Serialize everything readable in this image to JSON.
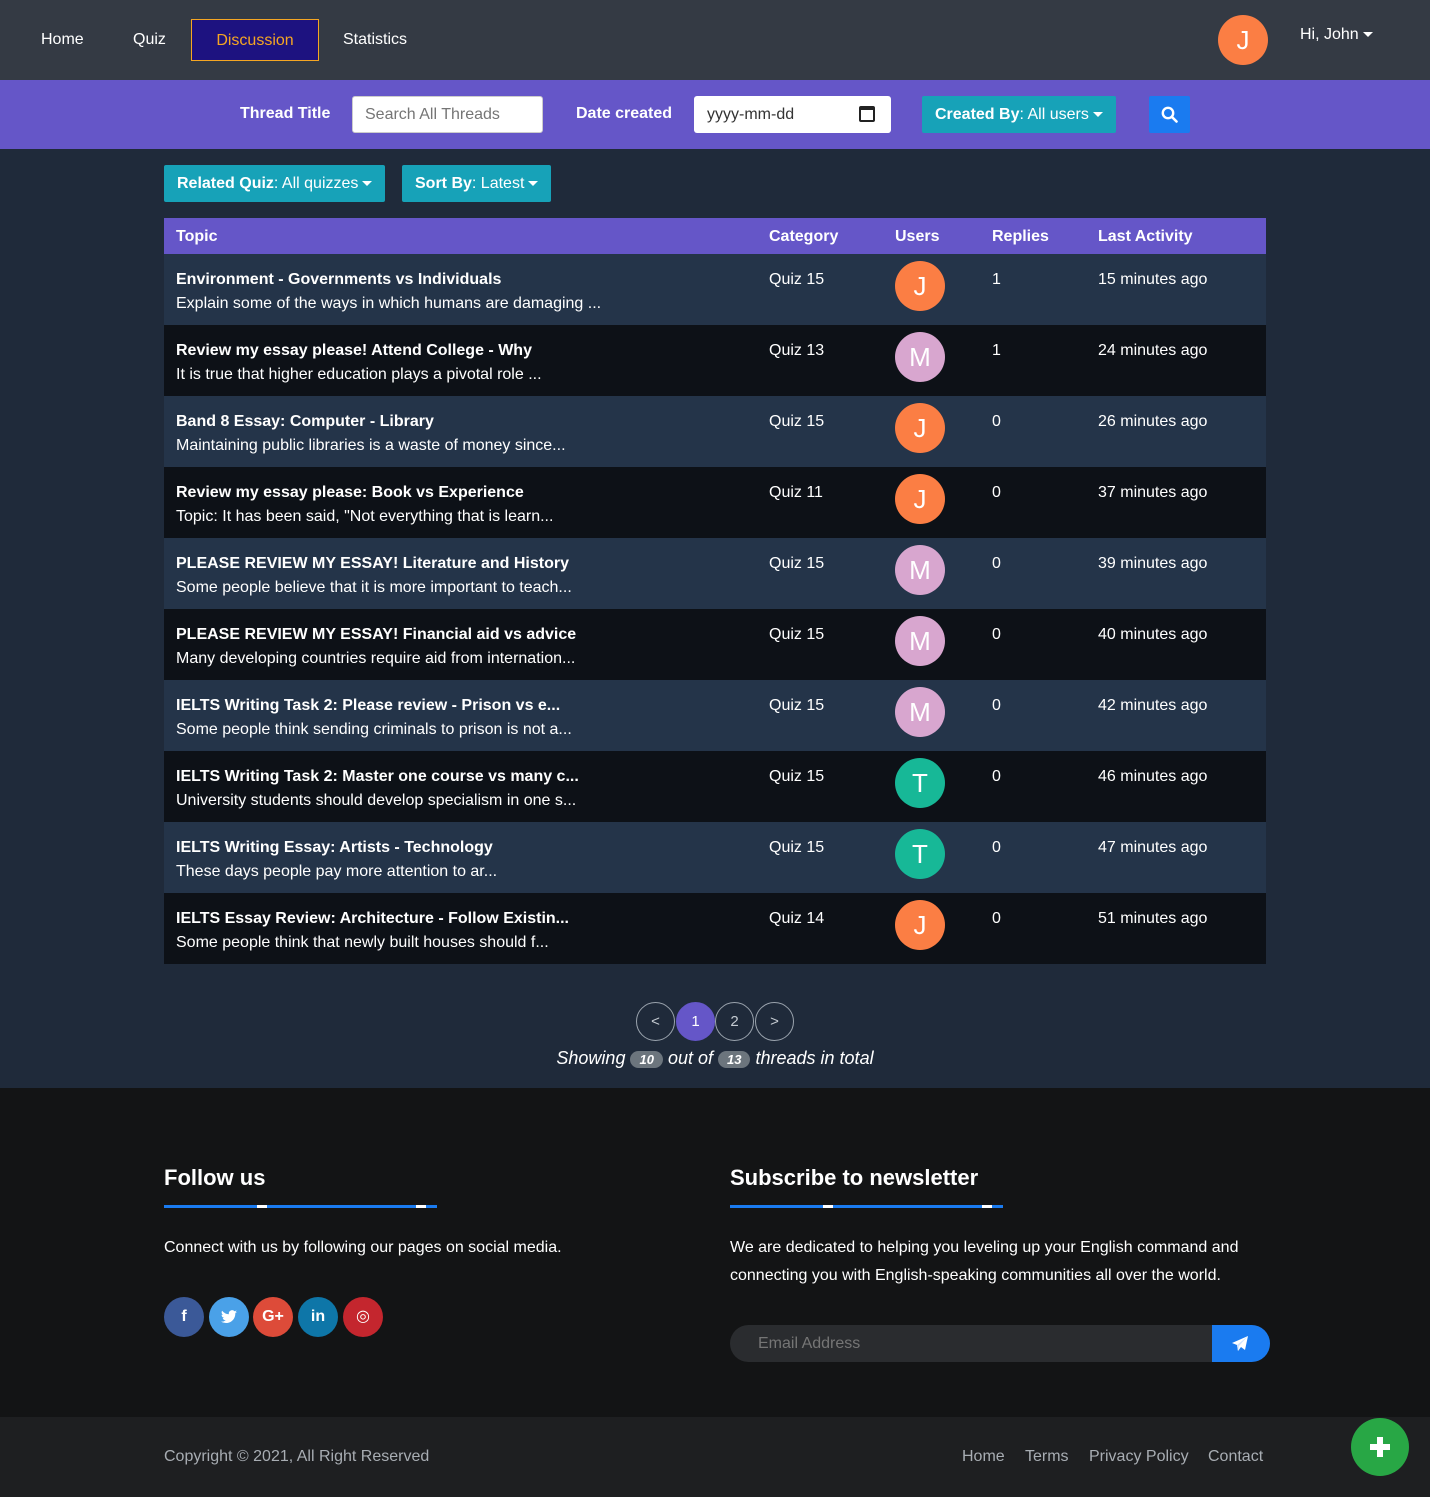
{
  "nav": {
    "items": [
      {
        "label": "Home"
      },
      {
        "label": "Quiz"
      },
      {
        "label": "Discussion"
      },
      {
        "label": "Statistics"
      }
    ],
    "avatar_letter": "J",
    "greeting": "Hi, John"
  },
  "filters": {
    "thread_title_label": "Thread Title",
    "search_placeholder": "Search All Threads",
    "date_label": "Date created",
    "date_placeholder": "yyyy-mm-dd",
    "created_by_key": "Created By",
    "created_by_value": ": All users",
    "related_quiz_key": "Related Quiz",
    "related_quiz_value": ": All quizzes",
    "sort_by_key": "Sort By",
    "sort_by_value": ": Latest"
  },
  "table": {
    "headers": {
      "topic": "Topic",
      "category": "Category",
      "users": "Users",
      "replies": "Replies",
      "last_activity": "Last Activity"
    },
    "rows": [
      {
        "title": "Environment - Governments vs Individuals",
        "excerpt": "Explain some of the ways in which humans are damaging ...",
        "category": "Quiz 15",
        "user": "J",
        "user_color": "#fb7e44",
        "replies": "1",
        "last": "15 minutes ago"
      },
      {
        "title": "Review my essay please! Attend College - Why",
        "excerpt": "It is true that higher education plays a pivotal role ...",
        "category": "Quiz 13",
        "user": "M",
        "user_color": "#d8a6cf",
        "replies": "1",
        "last": "24 minutes ago"
      },
      {
        "title": "Band 8 Essay: Computer - Library",
        "excerpt": "Maintaining public libraries is a waste of money since...",
        "category": "Quiz 15",
        "user": "J",
        "user_color": "#fb7e44",
        "replies": "0",
        "last": "26 minutes ago"
      },
      {
        "title": "Review my essay please: Book vs Experience",
        "excerpt": "Topic: It has been said, \"Not everything that is learn...",
        "category": "Quiz 11",
        "user": "J",
        "user_color": "#fb7e44",
        "replies": "0",
        "last": "37 minutes ago"
      },
      {
        "title": "PLEASE REVIEW MY ESSAY! Literature and History",
        "excerpt": "Some people believe that it is more important to teach...",
        "category": "Quiz 15",
        "user": "M",
        "user_color": "#d8a6cf",
        "replies": "0",
        "last": "39 minutes ago"
      },
      {
        "title": "PLEASE REVIEW MY ESSAY! Financial aid vs advice",
        "excerpt": "Many developing countries require aid from internation...",
        "category": "Quiz 15",
        "user": "M",
        "user_color": "#d8a6cf",
        "replies": "0",
        "last": "40 minutes ago"
      },
      {
        "title": "IELTS Writing Task 2: Please review - Prison vs e...",
        "excerpt": "Some people think sending criminals to prison is not a...",
        "category": "Quiz 15",
        "user": "M",
        "user_color": "#d8a6cf",
        "replies": "0",
        "last": "42 minutes ago"
      },
      {
        "title": "IELTS Writing Task 2: Master one course vs many c...",
        "excerpt": "University students should develop specialism in one s...",
        "category": "Quiz 15",
        "user": "T",
        "user_color": "#17b897",
        "replies": "0",
        "last": "46 minutes ago"
      },
      {
        "title": "IELTS Writing Essay: Artists - Technology",
        "excerpt": "These days people pay more attention to ar...",
        "category": "Quiz 15",
        "user": "T",
        "user_color": "#17b897",
        "replies": "0",
        "last": "47 minutes ago"
      },
      {
        "title": "IELTS Essay Review: Architecture - Follow Existin...",
        "excerpt": "Some people think that newly built houses should f...",
        "category": "Quiz 14",
        "user": "J",
        "user_color": "#fb7e44",
        "replies": "0",
        "last": "51 minutes ago"
      }
    ]
  },
  "pagination": {
    "prev": "<",
    "pages": [
      "1",
      "2"
    ],
    "next": ">",
    "showing_prefix": "Showing",
    "shown_count": "10",
    "out_of": "out of",
    "total_count": "13",
    "suffix": "threads in total"
  },
  "footer": {
    "follow_title": "Follow us",
    "follow_text": "Connect with us by following our pages on social media.",
    "social": [
      {
        "glyph": "f",
        "color": "#3b5998"
      },
      {
        "glyph": "t",
        "color": "#4aa1e8"
      },
      {
        "glyph": "G+",
        "color": "#dd4b39"
      },
      {
        "glyph": "in",
        "color": "#0e76a8"
      },
      {
        "glyph": "◎",
        "color": "#c4262e"
      }
    ],
    "subscribe_title": "Subscribe to newsletter",
    "subscribe_text_1": "We are dedicated to helping you leveling up your English command and",
    "subscribe_text_2": "connecting you with English-speaking communities all over the world.",
    "email_placeholder": "Email Address",
    "copyright": "Copyright © 2021, All Right Reserved",
    "links": [
      "Home",
      "Terms",
      "Privacy Policy",
      "Contact"
    ]
  }
}
